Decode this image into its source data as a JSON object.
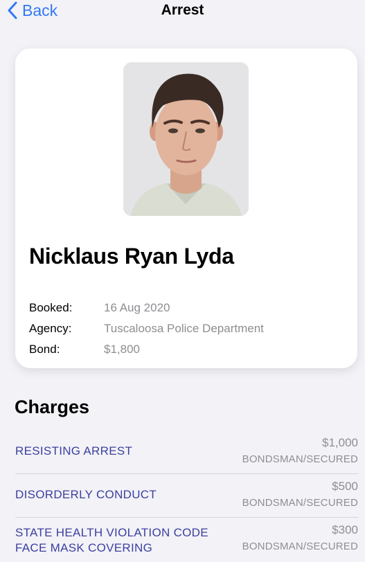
{
  "nav": {
    "back_label": "Back",
    "title": "Arrest"
  },
  "person": {
    "name": "Nicklaus Ryan Lyda",
    "photo_alt": "mugshot"
  },
  "details": [
    {
      "label": "Booked:",
      "value": "16 Aug 2020"
    },
    {
      "label": "Agency:",
      "value": "Tuscaloosa Police Department"
    },
    {
      "label": "Bond:",
      "value": "$1,800"
    }
  ],
  "charges_title": "Charges",
  "charges": [
    {
      "name_lines": [
        "RESISTING ARREST"
      ],
      "amount": "$1,000",
      "type": "BONDSMAN/SECURED"
    },
    {
      "name_lines": [
        "DISORDERLY CONDUCT"
      ],
      "amount": "$500",
      "type": "BONDSMAN/SECURED"
    },
    {
      "name_lines": [
        "STATE HEALTH VIOLATION CODE",
        "FACE MASK COVERING"
      ],
      "amount": "$300",
      "type": "BONDSMAN/SECURED"
    }
  ],
  "colors": {
    "accent": "#3478f6",
    "charge_text": "#3c3f9e",
    "secondary_text": "#8e8e93",
    "background": "#f2f2f7"
  },
  "icons": {
    "back": "chevron-left-icon"
  }
}
